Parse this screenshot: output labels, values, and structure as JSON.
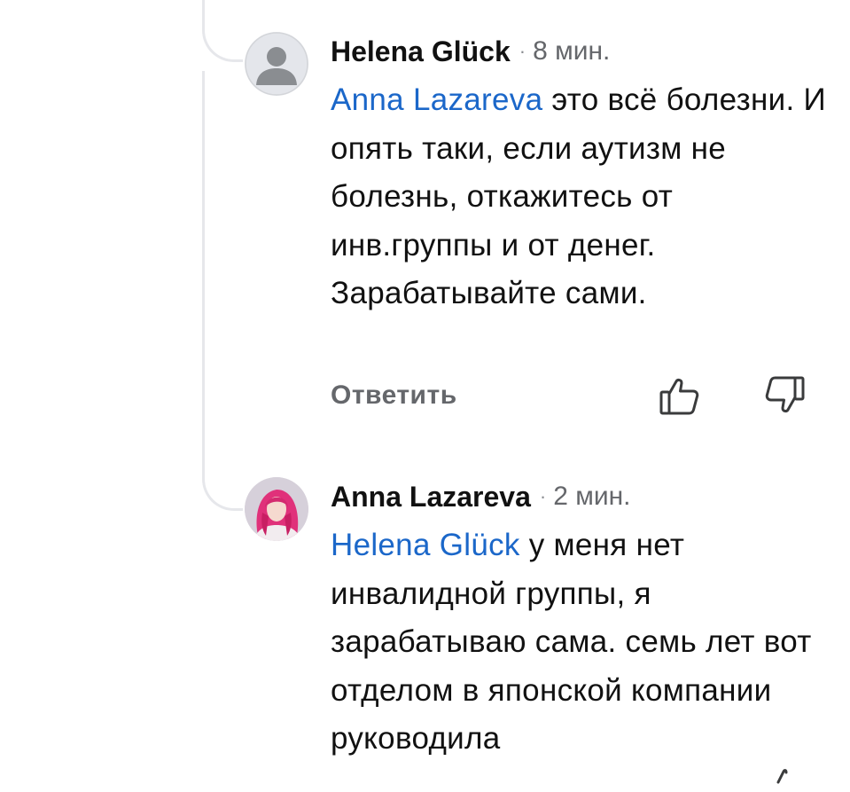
{
  "comments": [
    {
      "author": "Helena Glück",
      "separator": "·",
      "time": "8 мин.",
      "mention": "Anna Lazareva",
      "text": " это всё болезни.  И опять таки, если аутизм не болезнь, откажитесь от инв.группы и от денег. Зарабатывайте сами.",
      "avatar_icon": "default-user-avatar-icon"
    },
    {
      "author": "Anna Lazareva",
      "separator": "·",
      "time": "2 мин.",
      "mention": "Helena Glück",
      "text": " у меня нет инвалидной группы, я зарабатываю сама. семь лет вот отделом в японской компании руководила",
      "avatar_icon": "user-photo-avatar-icon"
    }
  ],
  "actions": {
    "reply_label": "Ответить",
    "like_icon": "thumbs-up-icon",
    "dislike_icon": "thumbs-down-icon"
  },
  "colors": {
    "mention": "#1b67c9",
    "text": "#111111",
    "muted": "#65676b",
    "thread_line": "#e6e7eb"
  }
}
